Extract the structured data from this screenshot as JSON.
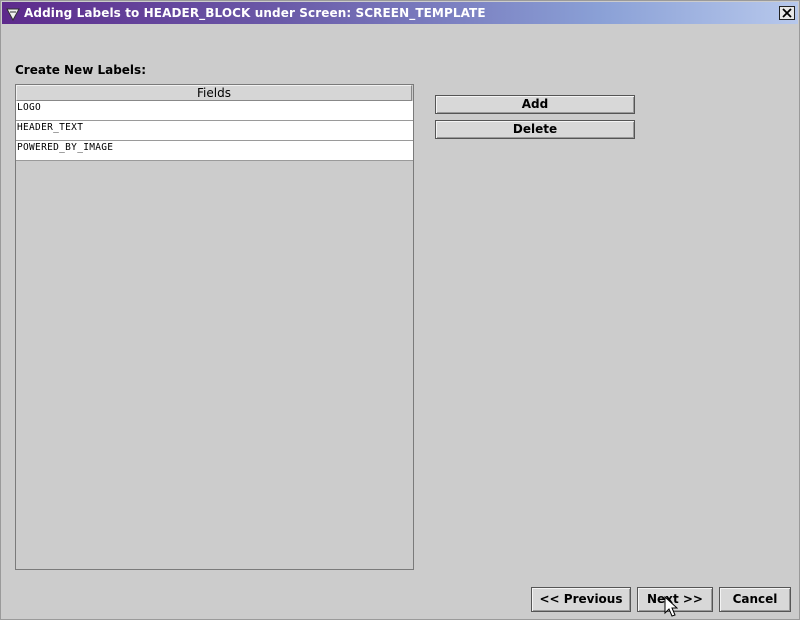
{
  "window": {
    "title": "Adding Labels to HEADER_BLOCK under Screen: SCREEN_TEMPLATE",
    "icon": "app-icon",
    "close_icon": "close-icon"
  },
  "content": {
    "section_label": "Create New Labels:",
    "table": {
      "header": "Fields",
      "rows": [
        "LOGO",
        "HEADER_TEXT",
        "POWERED_BY_IMAGE"
      ]
    }
  },
  "actions": {
    "add_label": "Add",
    "delete_label": "Delete"
  },
  "footer": {
    "previous_label": "<< Previous",
    "next_label": "Next >>",
    "cancel_label": "Cancel"
  },
  "colors": {
    "title_gradient_start": "#5d2a8c",
    "title_gradient_end": "#b7c8ec",
    "background": "#cccccc"
  }
}
